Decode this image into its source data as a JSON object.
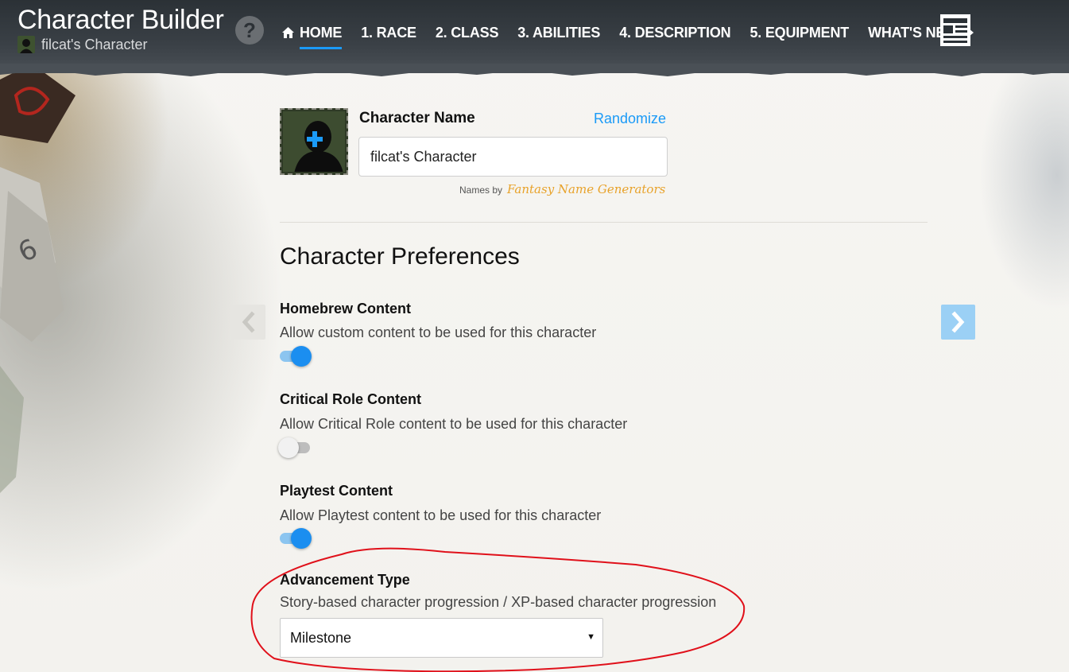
{
  "header": {
    "app_title": "Character Builder",
    "character_name": "filcat's Character",
    "help_symbol": "?",
    "nav": [
      {
        "label": "HOME",
        "active": true,
        "icon": "home-icon"
      },
      {
        "label": "1. RACE"
      },
      {
        "label": "2. CLASS"
      },
      {
        "label": "3. ABILITIES"
      },
      {
        "label": "4. DESCRIPTION"
      },
      {
        "label": "5. EQUIPMENT"
      },
      {
        "label": "WHAT'S NEXT",
        "icon": "caret-right-icon"
      }
    ],
    "sheet_icon": "character-sheet-icon"
  },
  "name_section": {
    "label": "Character Name",
    "randomize": "Randomize",
    "value": "filcat's Character",
    "names_by": "Names by",
    "brand": "Fantasy Name Generators",
    "portrait_icon": "add-portrait-icon"
  },
  "preferences": {
    "heading": "Character Preferences",
    "items": [
      {
        "title": "Homebrew Content",
        "desc": "Allow custom content to be used for this character",
        "enabled": true
      },
      {
        "title": "Critical Role Content",
        "desc": "Allow Critical Role content to be used for this character",
        "enabled": false
      },
      {
        "title": "Playtest Content",
        "desc": "Allow Playtest content to be used for this character",
        "enabled": true
      }
    ],
    "advancement": {
      "title": "Advancement Type",
      "desc": "Story-based character progression / XP-based character progression",
      "selected": "Milestone"
    }
  },
  "colors": {
    "accent": "#1b9af7",
    "header_bg": "#2b3136",
    "annotation": "#e0101a",
    "brand_orange": "#e8a22a"
  }
}
